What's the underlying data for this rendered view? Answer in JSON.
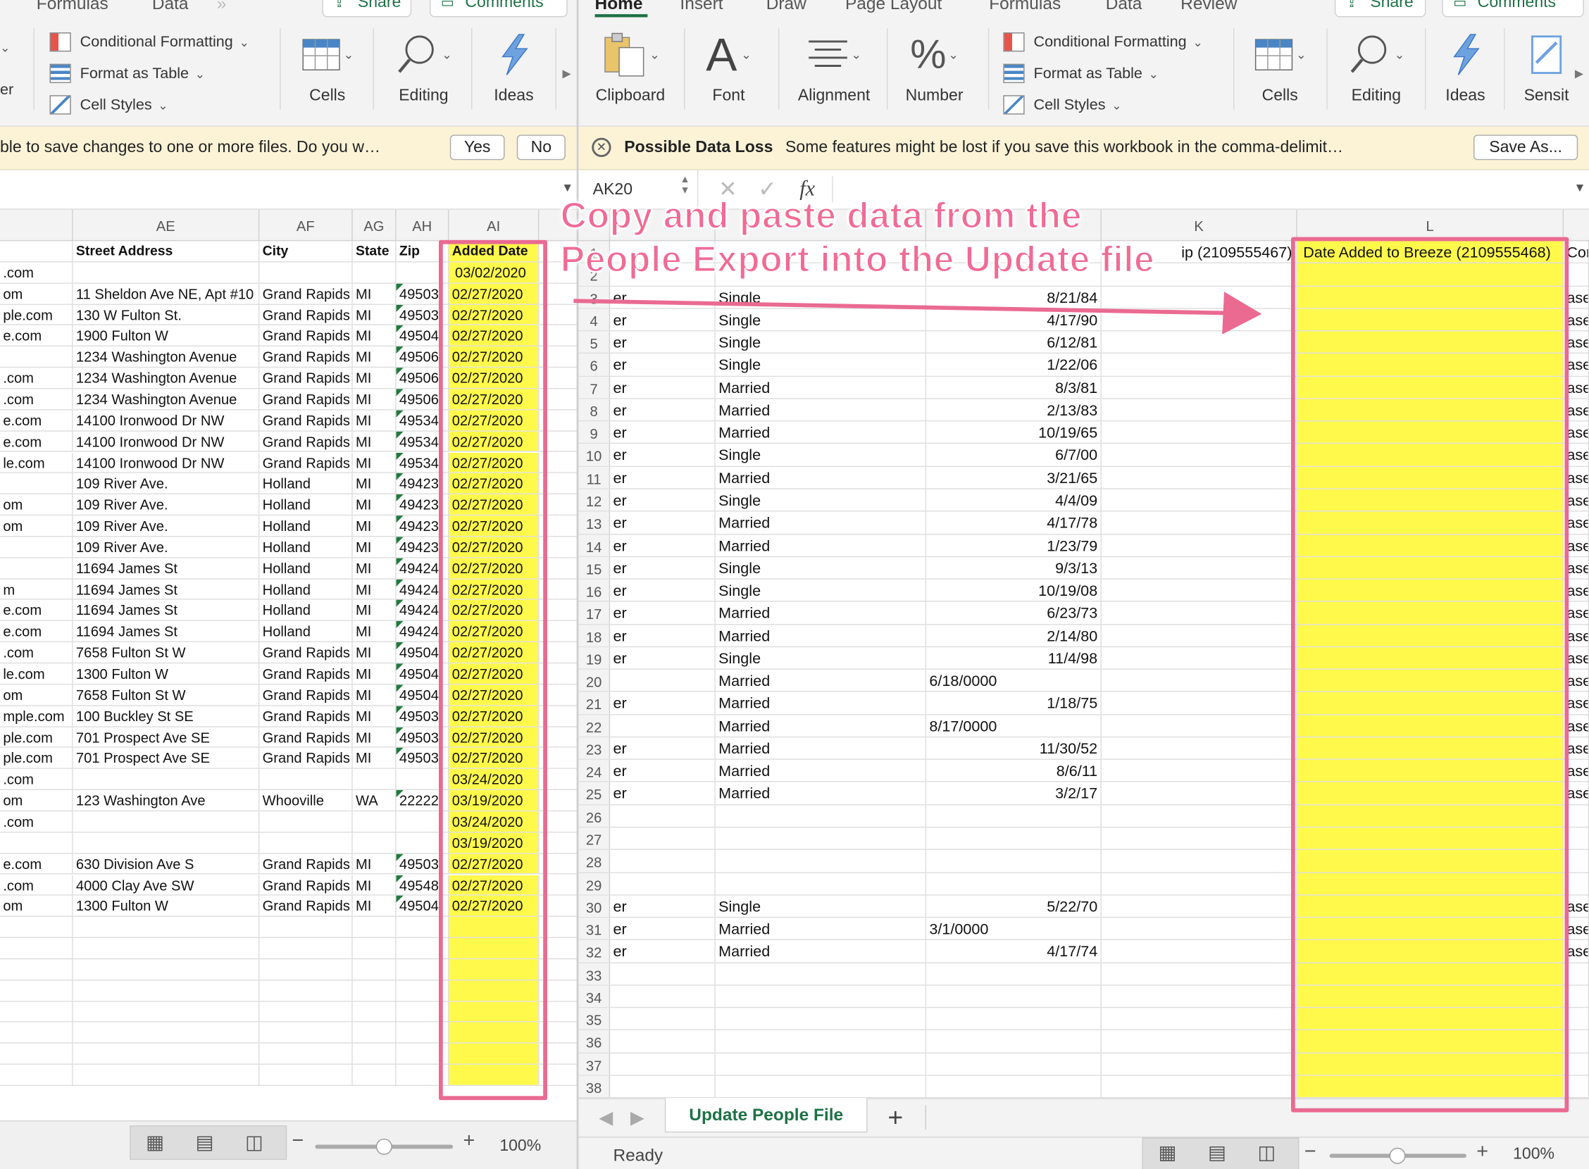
{
  "left": {
    "tabs": [
      "Formulas",
      "Data"
    ],
    "share_label": "Share",
    "comments_label": "Comments",
    "styles": {
      "cf": "Conditional Formatting",
      "fat": "Format as Table",
      "cs": "Cell Styles"
    },
    "groups": {
      "cells": "Cells",
      "editing": "Editing",
      "ideas": "Ideas"
    },
    "message": "ble to save changes to one or more files. Do you w…",
    "yes_label": "Yes",
    "no_label": "No",
    "columns": [
      "AE",
      "AF",
      "AG",
      "AH",
      "AI"
    ],
    "header": {
      "ae": "Street Address",
      "af": "City",
      "ag": "State",
      "ah": "Zip",
      "ai": "Added Date"
    },
    "rows": [
      {
        "ad": ".com",
        "ae": "",
        "af": "",
        "ag": "",
        "ah": "",
        "ai": "03/02/2020",
        "tri": false
      },
      {
        "ad": "om",
        "ae": "11 Sheldon Ave NE, Apt #10",
        "af": "Grand Rapids",
        "ag": "MI",
        "ah": "49503",
        "ai": "02/27/2020",
        "tri": true
      },
      {
        "ad": "ple.com",
        "ae": "130 W Fulton St.",
        "af": "Grand Rapids",
        "ag": "MI",
        "ah": "49503",
        "ai": "02/27/2020",
        "tri": true
      },
      {
        "ad": "e.com",
        "ae": "1900 Fulton W",
        "af": "Grand Rapids",
        "ag": "MI",
        "ah": "49504",
        "ai": "02/27/2020",
        "tri": true
      },
      {
        "ad": "",
        "ae": "1234 Washington Avenue",
        "af": "Grand Rapids",
        "ag": "MI",
        "ah": "49506",
        "ai": "02/27/2020",
        "tri": true
      },
      {
        "ad": ".com",
        "ae": "1234 Washington Avenue",
        "af": "Grand Rapids",
        "ag": "MI",
        "ah": "49506",
        "ai": "02/27/2020",
        "tri": true
      },
      {
        "ad": ".com",
        "ae": "1234 Washington Avenue",
        "af": "Grand Rapids",
        "ag": "MI",
        "ah": "49506",
        "ai": "02/27/2020",
        "tri": true
      },
      {
        "ad": "e.com",
        "ae": "14100 Ironwood Dr NW",
        "af": "Grand Rapids",
        "ag": "MI",
        "ah": "49534",
        "ai": "02/27/2020",
        "tri": true
      },
      {
        "ad": "e.com",
        "ae": "14100 Ironwood Dr NW",
        "af": "Grand Rapids",
        "ag": "MI",
        "ah": "49534",
        "ai": "02/27/2020",
        "tri": true
      },
      {
        "ad": "le.com",
        "ae": "14100 Ironwood Dr NW",
        "af": "Grand Rapids",
        "ag": "MI",
        "ah": "49534",
        "ai": "02/27/2020",
        "tri": true
      },
      {
        "ad": "",
        "ae": "109 River Ave.",
        "af": "Holland",
        "ag": "MI",
        "ah": "49423",
        "ai": "02/27/2020",
        "tri": true
      },
      {
        "ad": "om",
        "ae": "109 River Ave.",
        "af": "Holland",
        "ag": "MI",
        "ah": "49423",
        "ai": "02/27/2020",
        "tri": true
      },
      {
        "ad": "om",
        "ae": "109 River Ave.",
        "af": "Holland",
        "ag": "MI",
        "ah": "49423",
        "ai": "02/27/2020",
        "tri": true
      },
      {
        "ad": "",
        "ae": "109 River Ave.",
        "af": "Holland",
        "ag": "MI",
        "ah": "49423",
        "ai": "02/27/2020",
        "tri": true
      },
      {
        "ad": "",
        "ae": "11694 James St",
        "af": "Holland",
        "ag": "MI",
        "ah": "49424",
        "ai": "02/27/2020",
        "tri": true
      },
      {
        "ad": "m",
        "ae": "11694 James St",
        "af": "Holland",
        "ag": "MI",
        "ah": "49424",
        "ai": "02/27/2020",
        "tri": true
      },
      {
        "ad": "e.com",
        "ae": "11694 James St",
        "af": "Holland",
        "ag": "MI",
        "ah": "49424",
        "ai": "02/27/2020",
        "tri": true
      },
      {
        "ad": "e.com",
        "ae": "11694 James St",
        "af": "Holland",
        "ag": "MI",
        "ah": "49424",
        "ai": "02/27/2020",
        "tri": true
      },
      {
        "ad": ".com",
        "ae": "7658 Fulton St W",
        "af": "Grand Rapids",
        "ag": "MI",
        "ah": "49504",
        "ai": "02/27/2020",
        "tri": true
      },
      {
        "ad": "le.com",
        "ae": "1300 Fulton W",
        "af": "Grand Rapids",
        "ag": "MI",
        "ah": "49504",
        "ai": "02/27/2020",
        "tri": true
      },
      {
        "ad": "om",
        "ae": "7658 Fulton St W",
        "af": "Grand Rapids",
        "ag": "MI",
        "ah": "49504",
        "ai": "02/27/2020",
        "tri": true
      },
      {
        "ad": "mple.com",
        "ae": "100 Buckley St SE",
        "af": "Grand Rapids",
        "ag": "MI",
        "ah": "49503",
        "ai": "02/27/2020",
        "tri": true
      },
      {
        "ad": "ple.com",
        "ae": "701 Prospect Ave SE",
        "af": "Grand Rapids",
        "ag": "MI",
        "ah": "49503",
        "ai": "02/27/2020",
        "tri": true
      },
      {
        "ad": "ple.com",
        "ae": "701 Prospect Ave SE",
        "af": "Grand Rapids",
        "ag": "MI",
        "ah": "49503",
        "ai": "02/27/2020",
        "tri": true
      },
      {
        "ad": ".com",
        "ae": "",
        "af": "",
        "ag": "",
        "ah": "",
        "ai": "03/24/2020",
        "tri": false
      },
      {
        "ad": "om",
        "ae": "123 Washington Ave",
        "af": "Whooville",
        "ag": "WA",
        "ah": "22222",
        "ai": "03/19/2020",
        "tri": true
      },
      {
        "ad": ".com",
        "ae": "",
        "af": "",
        "ag": "",
        "ah": "",
        "ai": "03/24/2020",
        "tri": false
      },
      {
        "ad": "",
        "ae": "",
        "af": "",
        "ag": "",
        "ah": "",
        "ai": "03/19/2020",
        "tri": false
      },
      {
        "ad": "e.com",
        "ae": "630 Division Ave S",
        "af": "Grand Rapids",
        "ag": "MI",
        "ah": "49503",
        "ai": "02/27/2020",
        "tri": true
      },
      {
        "ad": ".com",
        "ae": "4000 Clay Ave SW",
        "af": "Grand Rapids",
        "ag": "MI",
        "ah": "49548",
        "ai": "02/27/2020",
        "tri": true
      },
      {
        "ad": "om",
        "ae": "1300 Fulton W",
        "af": "Grand Rapids",
        "ag": "MI",
        "ah": "49504",
        "ai": "02/27/2020",
        "tri": true
      }
    ],
    "zoom": "100%"
  },
  "right": {
    "tabs": [
      "Home",
      "Insert",
      "Draw",
      "Page Layout",
      "Formulas",
      "Data",
      "Review"
    ],
    "share_label": "Share",
    "comments_label": "Comments",
    "groups": {
      "clipboard": "Clipboard",
      "font": "Font",
      "alignment": "Alignment",
      "number": "Number",
      "cells": "Cells",
      "editing": "Editing",
      "ideas": "Ideas",
      "sensitivity": "Sensit"
    },
    "styles": {
      "cf": "Conditional Formatting",
      "fat": "Format as Table",
      "cs": "Cell Styles"
    },
    "warning_title": "Possible Data Loss",
    "warning_text": "Some features might be lost if you save this workbook in the comma-delimit…",
    "save_as_label": "Save As...",
    "name_box": "AK20",
    "fx_label": "fx",
    "columns": [
      "K",
      "L"
    ],
    "header_row": {
      "rn": "1",
      "a": "",
      "b": "",
      "c": "",
      "d": "ip (2109555467)",
      "l": "Date Added to Breeze (2109555468)",
      "m": "Con"
    },
    "rows": [
      {
        "rn": "2",
        "a": "",
        "b": "",
        "c": "",
        "d": "",
        "m": ""
      },
      {
        "rn": "3",
        "a": "er",
        "b": "Single",
        "c": "8/21/84",
        "d": "",
        "m": "ase"
      },
      {
        "rn": "4",
        "a": "er",
        "b": "Single",
        "c": "4/17/90",
        "d": "",
        "m": "ase"
      },
      {
        "rn": "5",
        "a": "er",
        "b": "Single",
        "c": "6/12/81",
        "d": "",
        "m": "ase"
      },
      {
        "rn": "6",
        "a": "er",
        "b": "Single",
        "c": "1/22/06",
        "d": "",
        "m": "ase"
      },
      {
        "rn": "7",
        "a": "er",
        "b": "Married",
        "c": "8/3/81",
        "d": "",
        "m": "ase"
      },
      {
        "rn": "8",
        "a": "er",
        "b": "Married",
        "c": "2/13/83",
        "d": "",
        "m": "ase"
      },
      {
        "rn": "9",
        "a": "er",
        "b": "Married",
        "c": "10/19/65",
        "d": "",
        "m": "ase"
      },
      {
        "rn": "10",
        "a": "er",
        "b": "Single",
        "c": "6/7/00",
        "d": "",
        "m": "ase"
      },
      {
        "rn": "11",
        "a": "er",
        "b": "Married",
        "c": "3/21/65",
        "d": "",
        "m": "ase"
      },
      {
        "rn": "12",
        "a": "er",
        "b": "Single",
        "c": "4/4/09",
        "d": "",
        "m": "ase"
      },
      {
        "rn": "13",
        "a": "er",
        "b": "Married",
        "c": "4/17/78",
        "d": "",
        "m": "ase"
      },
      {
        "rn": "14",
        "a": "er",
        "b": "Married",
        "c": "1/23/79",
        "d": "",
        "m": "ase"
      },
      {
        "rn": "15",
        "a": "er",
        "b": "Single",
        "c": "9/3/13",
        "d": "",
        "m": "ase"
      },
      {
        "rn": "16",
        "a": "er",
        "b": "Single",
        "c": "10/19/08",
        "d": "",
        "m": "ase"
      },
      {
        "rn": "17",
        "a": "er",
        "b": "Married",
        "c": "6/23/73",
        "d": "",
        "m": "ase"
      },
      {
        "rn": "18",
        "a": "er",
        "b": "Married",
        "c": "2/14/80",
        "d": "",
        "m": "ase"
      },
      {
        "rn": "19",
        "a": "er",
        "b": "Single",
        "c": "11/4/98",
        "d": "",
        "m": "ase"
      },
      {
        "rn": "20",
        "a": "",
        "b": "Married",
        "cl": "6/18/0000",
        "c": "",
        "d": "",
        "m": "ase"
      },
      {
        "rn": "21",
        "a": "er",
        "b": "Married",
        "c": "1/18/75",
        "d": "",
        "m": "ase"
      },
      {
        "rn": "22",
        "a": "",
        "b": "Married",
        "cl": "8/17/0000",
        "c": "",
        "d": "",
        "m": "ase"
      },
      {
        "rn": "23",
        "a": "er",
        "b": "Married",
        "c": "11/30/52",
        "d": "",
        "m": "ase"
      },
      {
        "rn": "24",
        "a": "er",
        "b": "Married",
        "c": "8/6/11",
        "d": "",
        "m": "ase"
      },
      {
        "rn": "25",
        "a": "er",
        "b": "Married",
        "c": "3/2/17",
        "d": "",
        "m": "ase"
      },
      {
        "rn": "26",
        "a": "",
        "b": "",
        "c": "",
        "d": "",
        "m": ""
      },
      {
        "rn": "27",
        "a": "",
        "b": "",
        "c": "",
        "d": "",
        "m": ""
      },
      {
        "rn": "28",
        "a": "",
        "b": "",
        "c": "",
        "d": "",
        "m": ""
      },
      {
        "rn": "29",
        "a": "",
        "b": "",
        "c": "",
        "d": "",
        "m": ""
      },
      {
        "rn": "30",
        "a": "er",
        "b": "Single",
        "c": "5/22/70",
        "d": "",
        "m": "ase"
      },
      {
        "rn": "31",
        "a": "er",
        "b": "Married",
        "cl": "3/1/0000",
        "c": "",
        "d": "",
        "m": "ase"
      },
      {
        "rn": "32",
        "a": "er",
        "b": "Married",
        "c": "4/17/74",
        "d": "",
        "m": "ase"
      },
      {
        "rn": "33",
        "a": "",
        "b": "",
        "c": "",
        "d": "",
        "m": ""
      },
      {
        "rn": "34",
        "a": "",
        "b": "",
        "c": "",
        "d": "",
        "m": ""
      },
      {
        "rn": "35",
        "a": "",
        "b": "",
        "c": "",
        "d": "",
        "m": ""
      },
      {
        "rn": "36",
        "a": "",
        "b": "",
        "c": "",
        "d": "",
        "m": ""
      },
      {
        "rn": "37",
        "a": "",
        "b": "",
        "c": "",
        "d": "",
        "m": ""
      },
      {
        "rn": "38",
        "a": "",
        "b": "",
        "c": "",
        "d": "",
        "m": ""
      }
    ],
    "sheet_tab": "Update People File",
    "add_sheet": "+",
    "status": "Ready",
    "zoom": "100%"
  },
  "annotation": {
    "line1": "Copy and paste data from the",
    "line2": "People Export into the Update file",
    "color": "#ea6a91",
    "highlight_fill": "#fff94b"
  }
}
